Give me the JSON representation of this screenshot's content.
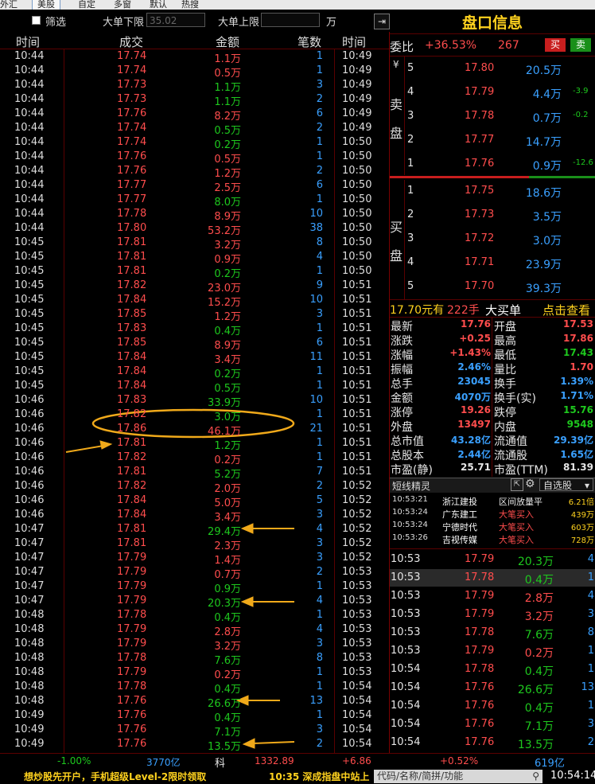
{
  "menu": [
    "外汇",
    "美股",
    "自定",
    "多窗",
    "默认",
    "热搜"
  ],
  "filter": {
    "filter_label": "筛选",
    "lower_label": "大单下限",
    "lower_value": "35.02",
    "upper_label": "大单上限",
    "upper_value": "",
    "unit": "万",
    "arrow_icon": "arrow-right-icon"
  },
  "table_headers": [
    "时间",
    "成交",
    "金额",
    "笔数",
    "时间"
  ],
  "trades": [
    {
      "t": "10:44",
      "p": "17.74",
      "a": "1.1万",
      "c": "1",
      "t2": "10:49",
      "pc": "red",
      "ac": "red"
    },
    {
      "t": "10:44",
      "p": "17.74",
      "a": "0.5万",
      "c": "1",
      "t2": "10:49",
      "pc": "red",
      "ac": "red"
    },
    {
      "t": "10:44",
      "p": "17.73",
      "a": "1.1万",
      "c": "3",
      "t2": "10:49",
      "pc": "red",
      "ac": "green"
    },
    {
      "t": "10:44",
      "p": "17.73",
      "a": "1.1万",
      "c": "2",
      "t2": "10:49",
      "pc": "red",
      "ac": "green"
    },
    {
      "t": "10:44",
      "p": "17.76",
      "a": "8.2万",
      "c": "6",
      "t2": "10:49",
      "pc": "red",
      "ac": "red"
    },
    {
      "t": "10:44",
      "p": "17.74",
      "a": "0.5万",
      "c": "2",
      "t2": "10:49",
      "pc": "red",
      "ac": "green"
    },
    {
      "t": "10:44",
      "p": "17.74",
      "a": "0.2万",
      "c": "1",
      "t2": "10:50",
      "pc": "red",
      "ac": "green"
    },
    {
      "t": "10:44",
      "p": "17.76",
      "a": "0.5万",
      "c": "1",
      "t2": "10:50",
      "pc": "red",
      "ac": "red"
    },
    {
      "t": "10:44",
      "p": "17.76",
      "a": "1.2万",
      "c": "2",
      "t2": "10:50",
      "pc": "red",
      "ac": "red"
    },
    {
      "t": "10:44",
      "p": "17.77",
      "a": "2.5万",
      "c": "6",
      "t2": "10:50",
      "pc": "red",
      "ac": "red"
    },
    {
      "t": "10:44",
      "p": "17.77",
      "a": "8.0万",
      "c": "1",
      "t2": "10:50",
      "pc": "red",
      "ac": "green"
    },
    {
      "t": "10:44",
      "p": "17.78",
      "a": "8.9万",
      "c": "10",
      "t2": "10:50",
      "pc": "red",
      "ac": "red"
    },
    {
      "t": "10:44",
      "p": "17.80",
      "a": "53.2万",
      "c": "38",
      "t2": "10:50",
      "pc": "red",
      "ac": "red"
    },
    {
      "t": "10:45",
      "p": "17.81",
      "a": "3.2万",
      "c": "8",
      "t2": "10:50",
      "pc": "red",
      "ac": "red"
    },
    {
      "t": "10:45",
      "p": "17.81",
      "a": "0.9万",
      "c": "4",
      "t2": "10:50",
      "pc": "red",
      "ac": "red"
    },
    {
      "t": "10:45",
      "p": "17.81",
      "a": "0.2万",
      "c": "1",
      "t2": "10:50",
      "pc": "red",
      "ac": "green"
    },
    {
      "t": "10:45",
      "p": "17.82",
      "a": "23.0万",
      "c": "9",
      "t2": "10:51",
      "pc": "red",
      "ac": "red"
    },
    {
      "t": "10:45",
      "p": "17.84",
      "a": "15.2万",
      "c": "10",
      "t2": "10:51",
      "pc": "red",
      "ac": "red"
    },
    {
      "t": "10:45",
      "p": "17.85",
      "a": "1.2万",
      "c": "3",
      "t2": "10:51",
      "pc": "red",
      "ac": "red"
    },
    {
      "t": "10:45",
      "p": "17.83",
      "a": "0.4万",
      "c": "1",
      "t2": "10:51",
      "pc": "red",
      "ac": "green"
    },
    {
      "t": "10:45",
      "p": "17.85",
      "a": "8.9万",
      "c": "6",
      "t2": "10:51",
      "pc": "red",
      "ac": "red"
    },
    {
      "t": "10:45",
      "p": "17.84",
      "a": "3.4万",
      "c": "11",
      "t2": "10:51",
      "pc": "red",
      "ac": "red"
    },
    {
      "t": "10:45",
      "p": "17.84",
      "a": "0.2万",
      "c": "1",
      "t2": "10:51",
      "pc": "red",
      "ac": "green"
    },
    {
      "t": "10:45",
      "p": "17.84",
      "a": "0.5万",
      "c": "1",
      "t2": "10:51",
      "pc": "red",
      "ac": "green"
    },
    {
      "t": "10:46",
      "p": "17.83",
      "a": "33.9万",
      "c": "10",
      "t2": "10:51",
      "pc": "red",
      "ac": "green"
    },
    {
      "t": "10:46",
      "p": "17.82",
      "a": "3.0万",
      "c": "1",
      "t2": "10:51",
      "pc": "red",
      "ac": "green"
    },
    {
      "t": "10:46",
      "p": "17.86",
      "a": "46.1万",
      "c": "21",
      "t2": "10:51",
      "pc": "red",
      "ac": "red"
    },
    {
      "t": "10:46",
      "p": "17.81",
      "a": "1.2万",
      "c": "1",
      "t2": "10:51",
      "pc": "red",
      "ac": "green"
    },
    {
      "t": "10:46",
      "p": "17.82",
      "a": "0.2万",
      "c": "1",
      "t2": "10:51",
      "pc": "red",
      "ac": "red"
    },
    {
      "t": "10:46",
      "p": "17.81",
      "a": "5.2万",
      "c": "7",
      "t2": "10:51",
      "pc": "red",
      "ac": "green"
    },
    {
      "t": "10:46",
      "p": "17.82",
      "a": "2.0万",
      "c": "2",
      "t2": "10:52",
      "pc": "red",
      "ac": "red"
    },
    {
      "t": "10:46",
      "p": "17.84",
      "a": "5.0万",
      "c": "5",
      "t2": "10:52",
      "pc": "red",
      "ac": "red"
    },
    {
      "t": "10:46",
      "p": "17.84",
      "a": "3.4万",
      "c": "3",
      "t2": "10:52",
      "pc": "red",
      "ac": "red"
    },
    {
      "t": "10:47",
      "p": "17.81",
      "a": "29.4万",
      "c": "4",
      "t2": "10:52",
      "pc": "red",
      "ac": "green"
    },
    {
      "t": "10:47",
      "p": "17.81",
      "a": "2.3万",
      "c": "3",
      "t2": "10:52",
      "pc": "red",
      "ac": "red"
    },
    {
      "t": "10:47",
      "p": "17.79",
      "a": "1.4万",
      "c": "3",
      "t2": "10:52",
      "pc": "red",
      "ac": "red"
    },
    {
      "t": "10:47",
      "p": "17.79",
      "a": "0.7万",
      "c": "2",
      "t2": "10:53",
      "pc": "red",
      "ac": "red"
    },
    {
      "t": "10:47",
      "p": "17.79",
      "a": "0.9万",
      "c": "1",
      "t2": "10:53",
      "pc": "red",
      "ac": "green"
    },
    {
      "t": "10:47",
      "p": "17.79",
      "a": "20.3万",
      "c": "4",
      "t2": "10:53",
      "pc": "red",
      "ac": "green"
    },
    {
      "t": "10:48",
      "p": "17.78",
      "a": "0.4万",
      "c": "1",
      "t2": "10:53",
      "pc": "red",
      "ac": "green"
    },
    {
      "t": "10:48",
      "p": "17.79",
      "a": "2.8万",
      "c": "4",
      "t2": "10:53",
      "pc": "red",
      "ac": "red"
    },
    {
      "t": "10:48",
      "p": "17.79",
      "a": "3.2万",
      "c": "3",
      "t2": "10:53",
      "pc": "red",
      "ac": "red"
    },
    {
      "t": "10:48",
      "p": "17.78",
      "a": "7.6万",
      "c": "8",
      "t2": "10:53",
      "pc": "red",
      "ac": "green"
    },
    {
      "t": "10:48",
      "p": "17.79",
      "a": "0.2万",
      "c": "1",
      "t2": "10:53",
      "pc": "red",
      "ac": "red"
    },
    {
      "t": "10:48",
      "p": "17.78",
      "a": "0.4万",
      "c": "1",
      "t2": "10:54",
      "pc": "red",
      "ac": "green"
    },
    {
      "t": "10:48",
      "p": "17.76",
      "a": "26.6万",
      "c": "13",
      "t2": "10:54",
      "pc": "red",
      "ac": "green"
    },
    {
      "t": "10:49",
      "p": "17.76",
      "a": "0.4万",
      "c": "1",
      "t2": "10:54",
      "pc": "red",
      "ac": "green"
    },
    {
      "t": "10:49",
      "p": "17.76",
      "a": "7.1万",
      "c": "3",
      "t2": "10:54",
      "pc": "red",
      "ac": "green"
    },
    {
      "t": "10:49",
      "p": "17.76",
      "a": "13.5万",
      "c": "2",
      "t2": "10:54",
      "pc": "red",
      "ac": "green"
    }
  ],
  "panel": {
    "title": "盘口信息",
    "weibi_label": "委比",
    "weibi_value": "+36.53%",
    "weicha_value": "267",
    "buy_btn": "买",
    "sell_btn": "卖",
    "sell_label": [
      "¥",
      "卖",
      "盘"
    ],
    "buy_label": [
      "买",
      "盘"
    ],
    "asks": [
      {
        "lvl": "5",
        "p": "17.80",
        "v": "20.5万",
        "chg": ""
      },
      {
        "lvl": "4",
        "p": "17.79",
        "v": "4.4万",
        "chg": "-3.9"
      },
      {
        "lvl": "3",
        "p": "17.78",
        "v": "0.7万",
        "chg": "-0.2"
      },
      {
        "lvl": "2",
        "p": "17.77",
        "v": "14.7万",
        "chg": ""
      },
      {
        "lvl": "1",
        "p": "17.76",
        "v": "0.9万",
        "chg": "-12.6"
      }
    ],
    "bids": [
      {
        "lvl": "1",
        "p": "17.75",
        "v": "18.6万"
      },
      {
        "lvl": "2",
        "p": "17.73",
        "v": "3.5万"
      },
      {
        "lvl": "3",
        "p": "17.72",
        "v": "3.0万"
      },
      {
        "lvl": "4",
        "p": "17.71",
        "v": "23.9万"
      },
      {
        "lvl": "5",
        "p": "17.70",
        "v": "39.3万"
      }
    ],
    "bigbuy_price": "17.70元有",
    "bigbuy_qty": "222手",
    "bigbuy_label": "大买单",
    "bigbuy_link": "点击查看",
    "stats_left": [
      {
        "k": "最新",
        "v": "17.76",
        "c": "red"
      },
      {
        "k": "涨跌",
        "v": "+0.25",
        "c": "red"
      },
      {
        "k": "涨幅",
        "v": "+1.43%",
        "c": "red"
      },
      {
        "k": "振幅",
        "v": "2.46%",
        "c": "blue"
      },
      {
        "k": "总手",
        "v": "23045",
        "c": "blue"
      },
      {
        "k": "金额",
        "v": "4070万",
        "c": "blue"
      },
      {
        "k": "涨停",
        "v": "19.26",
        "c": "red"
      },
      {
        "k": "外盘",
        "v": "13497",
        "c": "red"
      },
      {
        "k": "总市值",
        "v": "43.28亿",
        "c": "blue"
      },
      {
        "k": "总股本",
        "v": "2.44亿",
        "c": "blue"
      },
      {
        "k": "市盈(静)",
        "v": "25.71",
        "c": "white"
      }
    ],
    "stats_right": [
      {
        "k": "开盘",
        "v": "17.53",
        "c": "red"
      },
      {
        "k": "最高",
        "v": "17.86",
        "c": "red"
      },
      {
        "k": "最低",
        "v": "17.43",
        "c": "green"
      },
      {
        "k": "量比",
        "v": "1.70",
        "c": "red"
      },
      {
        "k": "换手",
        "v": "1.39%",
        "c": "blue"
      },
      {
        "k": "换手(实)",
        "v": "1.71%",
        "c": "blue"
      },
      {
        "k": "跌停",
        "v": "15.76",
        "c": "green"
      },
      {
        "k": "内盘",
        "v": "9548",
        "c": "green"
      },
      {
        "k": "流通值",
        "v": "29.39亿",
        "c": "blue"
      },
      {
        "k": "流通股",
        "v": "1.65亿",
        "c": "blue"
      },
      {
        "k": "市盈(TTM)",
        "v": "81.39",
        "c": "white"
      }
    ],
    "sprite_tab": "短线精灵",
    "watchlist_btn": "自选股",
    "sprite_rows": [
      {
        "time": "10:53:21",
        "name": "浙江建投",
        "event": "区间放量平",
        "val": "6.21倍",
        "ec": "white"
      },
      {
        "time": "10:53:24",
        "name": "广东建工",
        "event": "大笔买入",
        "val": "439万",
        "ec": "red"
      },
      {
        "time": "10:53:24",
        "name": "宁德时代",
        "event": "大笔买入",
        "val": "603万",
        "ec": "red"
      },
      {
        "time": "10:53:26",
        "name": "吉视传媒",
        "event": "大笔买入",
        "val": "728万",
        "ec": "red"
      }
    ],
    "ticks": [
      {
        "t": "10:53",
        "p": "17.79",
        "v": "20.3万",
        "n": "4",
        "vc": "green"
      },
      {
        "t": "10:53",
        "p": "17.78",
        "v": "0.4万",
        "n": "1",
        "vc": "green"
      },
      {
        "t": "10:53",
        "p": "17.79",
        "v": "2.8万",
        "n": "4",
        "vc": "red"
      },
      {
        "t": "10:53",
        "p": "17.79",
        "v": "3.2万",
        "n": "3",
        "vc": "red"
      },
      {
        "t": "10:53",
        "p": "17.78",
        "v": "7.6万",
        "n": "8",
        "vc": "green"
      },
      {
        "t": "10:53",
        "p": "17.79",
        "v": "0.2万",
        "n": "1",
        "vc": "red"
      },
      {
        "t": "10:54",
        "p": "17.78",
        "v": "0.4万",
        "n": "1",
        "vc": "green"
      },
      {
        "t": "10:54",
        "p": "17.76",
        "v": "26.6万",
        "n": "13",
        "vc": "green"
      },
      {
        "t": "10:54",
        "p": "17.76",
        "v": "0.4万",
        "n": "1",
        "vc": "green"
      },
      {
        "t": "10:54",
        "p": "17.76",
        "v": "7.1万",
        "n": "3",
        "vc": "green"
      },
      {
        "t": "10:54",
        "p": "17.76",
        "v": "13.5万",
        "n": "2",
        "vc": "green"
      }
    ]
  },
  "footer": {
    "idx1_pct": "-1.00%",
    "idx1_amt": "3770亿",
    "idx2_name": "科",
    "idx2_val": "1332.89",
    "idx2_chg": "+6.86",
    "idx2_pct": "+0.52%",
    "idx2_amt": "619亿",
    "ticker": "想炒股先开户，手机超级Level-2限时领取",
    "news": "10:35 深成指盘中站上",
    "search_placeholder": "代码/名称/简拼/功能",
    "clock": "10:54:14"
  },
  "colors": {
    "red": "#ff4d4d",
    "green": "#1ec81e",
    "blue": "#3aa0ff",
    "yellow": "#ffd21e",
    "highlight": "#f0a91a"
  }
}
